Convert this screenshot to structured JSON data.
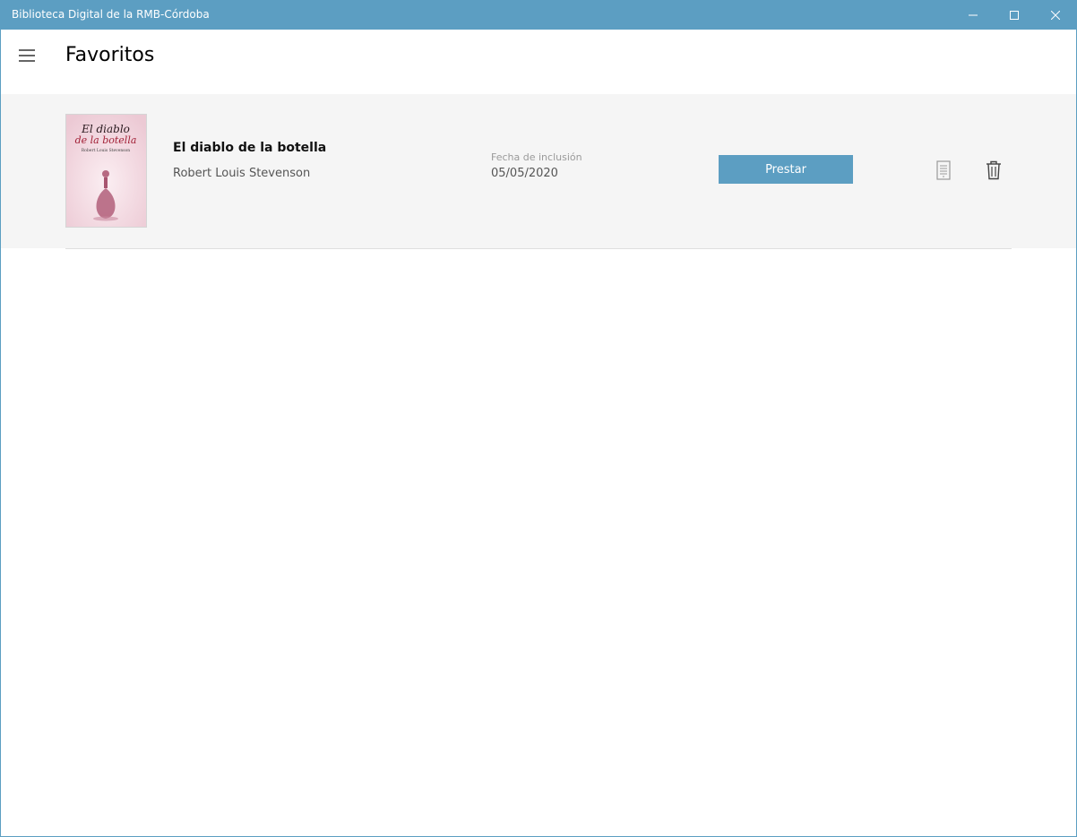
{
  "window": {
    "title": "Biblioteca Digital de la RMB-Córdoba",
    "accent_color": "#5c9ec2"
  },
  "header": {
    "menu_icon": "hamburger-icon",
    "title": "Favoritos"
  },
  "favorites": [
    {
      "cover": {
        "title_line1": "El diablo",
        "title_line2": "de la botella",
        "author": "Robert Louis Stevenson"
      },
      "title": "El diablo de la botella",
      "author": "Robert Louis Stevenson",
      "date_label": "Fecha de inclusión",
      "date": "05/05/2020",
      "action_label": "Prestar",
      "details_icon": "document-icon",
      "delete_icon": "trash-icon"
    }
  ]
}
